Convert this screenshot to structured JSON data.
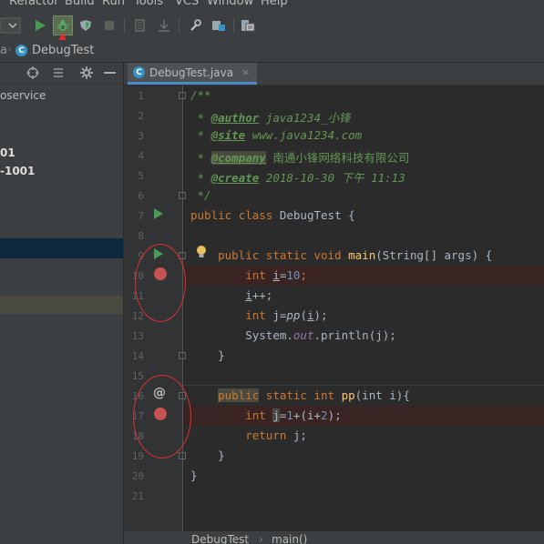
{
  "menu": [
    {
      "label": "Refactor"
    },
    {
      "label": "Build"
    },
    {
      "label": "Run"
    },
    {
      "label": "Tools"
    },
    {
      "label": "VCS"
    },
    {
      "label": "Window"
    },
    {
      "label": "Help"
    }
  ],
  "navbar": {
    "crumb_prefix": "a",
    "crumb_file": "DebugTest"
  },
  "project": {
    "service_label": "oservice",
    "item1": "01",
    "item2": "-1001"
  },
  "editor": {
    "tab_label": "DebugTest.java",
    "tab_close": "×"
  },
  "code_lines": [
    {
      "n": "1",
      "t": "/**"
    },
    {
      "n": "2"
    },
    {
      "n": "3"
    },
    {
      "n": "4"
    },
    {
      "n": "5"
    },
    {
      "n": "6",
      "t": " */"
    },
    {
      "n": "7"
    },
    {
      "n": "8"
    },
    {
      "n": "9"
    },
    {
      "n": "10"
    },
    {
      "n": "11"
    },
    {
      "n": "12"
    },
    {
      "n": "13"
    },
    {
      "n": "14",
      "t": "    }"
    },
    {
      "n": "15",
      "t": ""
    },
    {
      "n": "16"
    },
    {
      "n": "17"
    },
    {
      "n": "18"
    },
    {
      "n": "19",
      "t": "    }"
    },
    {
      "n": "20",
      "t": "}"
    },
    {
      "n": "21",
      "t": ""
    }
  ],
  "doc": {
    "author_tag": "@author",
    "author_val": " java1234_小锋",
    "site_tag": "@site",
    "site_val": " www.java1234.com",
    "company_tag": "@company",
    "company_val": " 南通小锋网络科技有限公司",
    "create_tag": "@create",
    "create_val": " 2018-10-30 下午 11:13"
  },
  "code": {
    "public": "public",
    "class": "class",
    "static": "static",
    "void": "void",
    "int": "int",
    "return": "return",
    "class_name": "DebugTest",
    "main": "main",
    "main_params": "(String[] args) {",
    "pp": "pp",
    "pp_params": "(int i){",
    "i_var": "i",
    "j_var": "j",
    "eq": "=",
    "ten": "10",
    "one": "1",
    "two": "2",
    "semi": ";",
    "iplus": "++;",
    "system": "System.",
    "out": "out",
    "println": ".println(j);",
    "pp_call_open": "(",
    "pp_call_close": ");",
    "plus_paren": "+(i+",
    "close_semi": ");",
    "ret_j": " j;"
  },
  "statusbar": {
    "crumb1": "DebugTest",
    "sep": "›",
    "crumb2": "main()"
  },
  "colors": {
    "breakpoint": "#c75450",
    "run": "#499c54",
    "annotation": "#e03030",
    "keyword": "#cc7832",
    "doc": "#629755"
  }
}
